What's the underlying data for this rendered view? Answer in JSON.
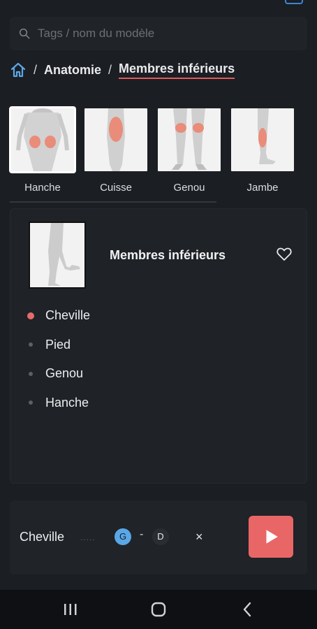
{
  "search": {
    "placeholder": "Tags / nom du modèle"
  },
  "breadcrumb": {
    "items": [
      "Anatomie",
      "Membres inférieurs"
    ],
    "separator": "/"
  },
  "thumbnails": [
    {
      "label": "Hanche"
    },
    {
      "label": "Cuisse"
    },
    {
      "label": "Genou"
    },
    {
      "label": "Jambe"
    }
  ],
  "card": {
    "title": "Membres inférieurs",
    "items": [
      "Cheville",
      "Pied",
      "Genou",
      "Hanche"
    ]
  },
  "player": {
    "name": "Cheville",
    "left_label": "G",
    "separator": "-",
    "right_label": "D",
    "close": "×"
  },
  "colors": {
    "accent": "#e96666",
    "blue": "#5aa7e6",
    "background": "#1b1e23"
  }
}
